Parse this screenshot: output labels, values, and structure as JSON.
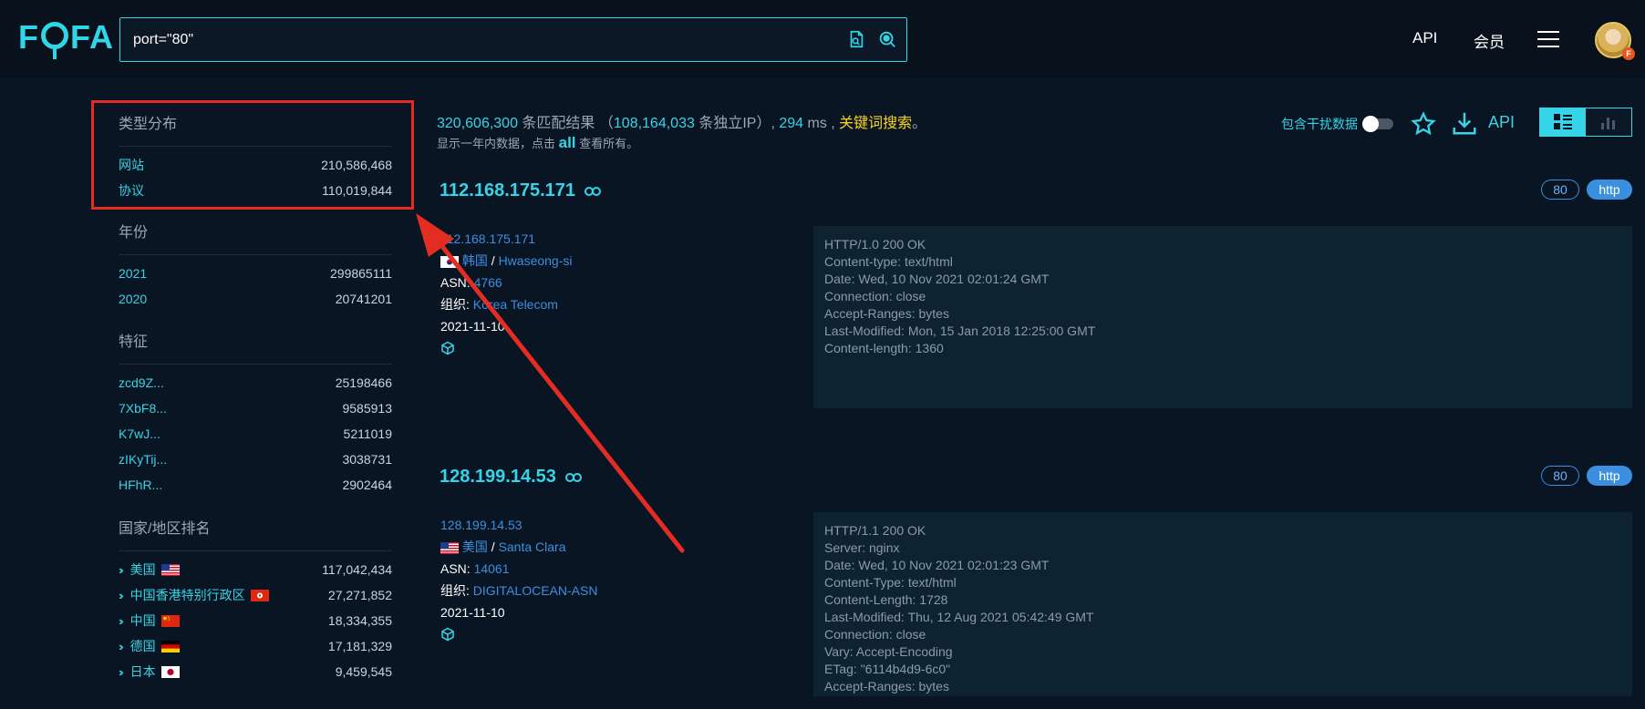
{
  "header": {
    "logo_text_left": "F",
    "logo_text_right": "FA",
    "search_value": "port=\"80\"",
    "nav_api": "API",
    "nav_member": "会员",
    "avatar_badge": "F",
    "icons": [
      "file-search-icon",
      "search-icon",
      "menu-icon",
      "avatar"
    ]
  },
  "sidebar": {
    "type": {
      "title": "类型分布",
      "rows": [
        {
          "k": "网站",
          "v": "210,586,468"
        },
        {
          "k": "协议",
          "v": "110,019,844"
        }
      ]
    },
    "year": {
      "title": "年份",
      "rows": [
        {
          "k": "2021",
          "v": "299865111"
        },
        {
          "k": "2020",
          "v": "20741201"
        }
      ]
    },
    "feature": {
      "title": "特征",
      "rows": [
        {
          "k": "zcd9Z...",
          "v": "25198466"
        },
        {
          "k": "7XbF8...",
          "v": "9585913"
        },
        {
          "k": "K7wJ...",
          "v": "5211019"
        },
        {
          "k": "zIKyTij...",
          "v": "3038731"
        },
        {
          "k": "HFhR...",
          "v": "2902464"
        }
      ]
    },
    "country": {
      "title": "国家/地区排名",
      "rows": [
        {
          "k": "美国",
          "v": "117,042,434",
          "flag": "us"
        },
        {
          "k": "中国香港特别行政区",
          "v": "27,271,852",
          "flag": "hk"
        },
        {
          "k": "中国",
          "v": "18,334,355",
          "flag": "cn"
        },
        {
          "k": "德国",
          "v": "17,181,329",
          "flag": "de"
        },
        {
          "k": "日本",
          "v": "9,459,545",
          "flag": "jp"
        }
      ]
    }
  },
  "summary": {
    "total": "320,606,300",
    "total_suffix": " 条匹配结果 （",
    "unique_ip": "108,164,033",
    "unique_suffix": " 条独立IP）, ",
    "ms": "294",
    "ms_suffix": " ms , ",
    "keyword": "关键词搜索",
    "end": "。",
    "sub_prefix": "显示一年内数据，点击 ",
    "sub_all": "all",
    "sub_suffix": " 查看所有。",
    "interference": "包含干扰数据",
    "api": "API"
  },
  "results": [
    {
      "ip": "112.168.175.171",
      "port": "80",
      "protocol": "http",
      "link_ip": "112.168.175.171",
      "country": "韩国",
      "city": "Hwaseong-si",
      "asn_label": "ASN: ",
      "asn": "4766",
      "org_label": "组织: ",
      "org": "Korea Telecom",
      "date": "2021-11-10",
      "banner": [
        "HTTP/1.0 200 OK",
        "Content-type: text/html",
        "Date: Wed, 10 Nov 2021 02:01:24 GMT",
        "Connection: close",
        "Accept-Ranges: bytes",
        "Last-Modified: Mon, 15 Jan 2018 12:25:00 GMT",
        "Content-length: 1360"
      ]
    },
    {
      "ip": "128.199.14.53",
      "port": "80",
      "protocol": "http",
      "link_ip": "128.199.14.53",
      "country": "美国",
      "city": "Santa Clara",
      "asn_label": "ASN: ",
      "asn": "14061",
      "org_label": "组织: ",
      "org": "DIGITALOCEAN-ASN",
      "date": "2021-11-10",
      "banner": [
        "HTTP/1.1 200 OK",
        "Server: nginx",
        "Date: Wed, 10 Nov 2021 02:01:23 GMT",
        "Content-Type: text/html",
        "Content-Length: 1728",
        "Last-Modified: Thu, 12 Aug 2021 05:42:49 GMT",
        "Connection: close",
        "Vary: Accept-Encoding",
        "ETag: \"6114b4d9-6c0\"",
        "Accept-Ranges: bytes"
      ]
    }
  ],
  "colors": {
    "accent": "#36d4e6",
    "link": "#3a8fe0",
    "keyword": "#f7d51e",
    "annotation": "#e32d23"
  }
}
